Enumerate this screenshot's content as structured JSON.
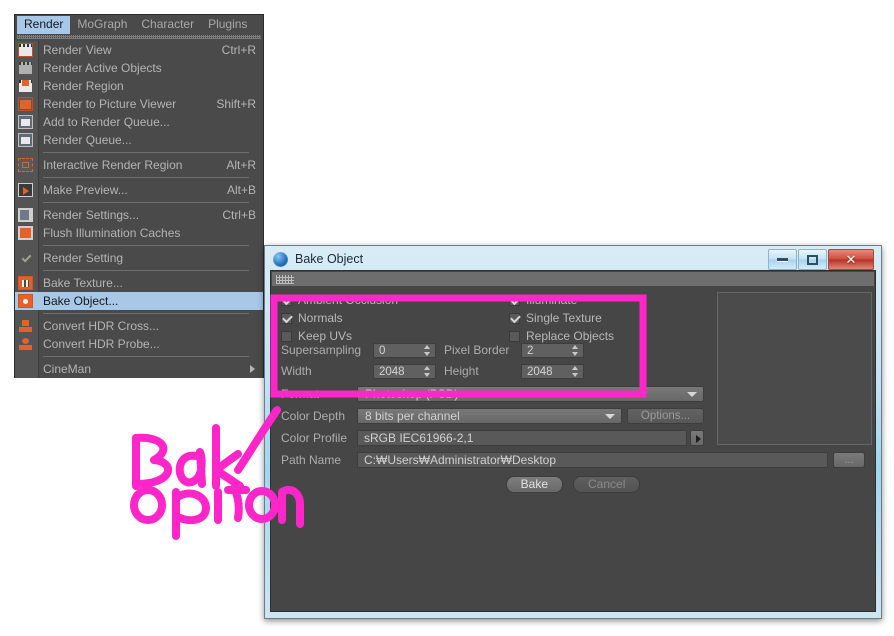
{
  "menu": {
    "menubar": [
      {
        "label": "Render",
        "active": true
      },
      {
        "label": "MoGraph",
        "active": false
      },
      {
        "label": "Character",
        "active": false
      },
      {
        "label": "Plugins",
        "active": false
      }
    ],
    "items": [
      {
        "label": "Render View",
        "accel": "Ctrl+R",
        "icon": "render-view-icon",
        "highlighted": false
      },
      {
        "label": "Render Active Objects",
        "accel": "",
        "icon": "render-active-objects-icon",
        "highlighted": false
      },
      {
        "label": "Render Region",
        "accel": "",
        "icon": "render-region-icon",
        "highlighted": false
      },
      {
        "label": "Render to Picture Viewer",
        "accel": "Shift+R",
        "icon": "picture-viewer-icon",
        "highlighted": false
      },
      {
        "label": "Add to Render Queue...",
        "accel": "",
        "icon": "add-render-queue-icon",
        "highlighted": false
      },
      {
        "label": "Render Queue...",
        "accel": "",
        "icon": "render-queue-icon",
        "highlighted": false
      },
      {
        "label": "Interactive Render Region",
        "accel": "Alt+R",
        "icon": "interactive-render-region-icon",
        "highlighted": false
      },
      {
        "label": "Make Preview...",
        "accel": "Alt+B",
        "icon": "make-preview-icon",
        "highlighted": false
      },
      {
        "label": "Render Settings...",
        "accel": "Ctrl+B",
        "icon": "render-settings-icon",
        "highlighted": false
      },
      {
        "label": "Flush Illumination Caches",
        "accel": "",
        "icon": "flush-illumination-caches-icon",
        "highlighted": false
      },
      {
        "label": "Render Setting",
        "accel": "",
        "icon": "checkmark-icon",
        "highlighted": false
      },
      {
        "label": "Bake Texture...",
        "accel": "",
        "icon": "bake-texture-icon",
        "highlighted": false
      },
      {
        "label": "Bake Object...",
        "accel": "",
        "icon": "bake-object-icon",
        "highlighted": true
      },
      {
        "label": "Convert HDR Cross...",
        "accel": "",
        "icon": "convert-hdr-cross-icon",
        "highlighted": false
      },
      {
        "label": "Convert HDR Probe...",
        "accel": "",
        "icon": "convert-hdr-probe-icon",
        "highlighted": false
      },
      {
        "label": "CineMan",
        "accel": "",
        "icon": "none",
        "highlighted": false,
        "submenu": true
      }
    ]
  },
  "dialog": {
    "title": "Bake Object",
    "window_buttons": {
      "minimize": "minimize-button",
      "maximize": "maximize-button",
      "close": "close-button"
    },
    "checkboxes": [
      {
        "label": "Ambient Occlusion",
        "checked": true
      },
      {
        "label": "Illuminate",
        "checked": true
      },
      {
        "label": "Normals",
        "checked": true
      },
      {
        "label": "Single Texture",
        "checked": true
      },
      {
        "label": "Keep UVs",
        "checked": false
      },
      {
        "label": "Replace Objects",
        "checked": false
      }
    ],
    "fields": {
      "supersampling_label": "Supersampling",
      "supersampling_value": "0",
      "pixel_border_label": "Pixel Border",
      "pixel_border_value": "2",
      "width_label": "Width",
      "width_value": "2048",
      "height_label": "Height",
      "height_value": "2048",
      "format_label": "Format",
      "format_value": "Photoshop (PSD)",
      "color_depth_label": "Color Depth",
      "color_depth_value": "8 bits per channel",
      "options_button": "Options...",
      "color_profile_label": "Color Profile",
      "color_profile_value": "sRGB IEC61966-2,1",
      "path_name_label": "Path Name",
      "path_name_value": "C:₩Users₩Administrator₩Desktop",
      "browse_button": "..."
    },
    "buttons": {
      "bake": "Bake",
      "cancel": "Cancel"
    }
  },
  "annotation": {
    "line1": "Bake",
    "line2": "option",
    "color": "#ff26c9"
  }
}
